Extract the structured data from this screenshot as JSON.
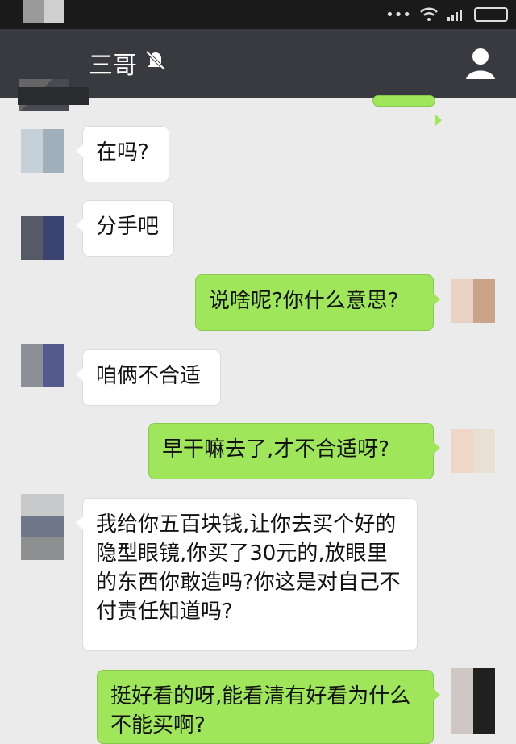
{
  "window": {
    "title": "三哥"
  },
  "status_icons": [
    "wifi-icon",
    "signal-icon",
    "battery-icon"
  ],
  "messages": [
    {
      "side": "left",
      "text": "在吗?"
    },
    {
      "side": "left",
      "text": "分手吧"
    },
    {
      "side": "right",
      "text": "说啥呢?你什么意思?"
    },
    {
      "side": "left",
      "text": "咱俩不合适"
    },
    {
      "side": "right",
      "text": "早干嘛去了,才不合适呀?"
    },
    {
      "side": "left",
      "text": "我给你五百块钱,让你去买个好的隐型眼镜,你买了30元的,放眼里的东西你敢造吗?你这是对自己不付责任知道吗?"
    },
    {
      "side": "right",
      "text": "挺好看的呀,能看清有好看为什么不能买啊?"
    }
  ]
}
